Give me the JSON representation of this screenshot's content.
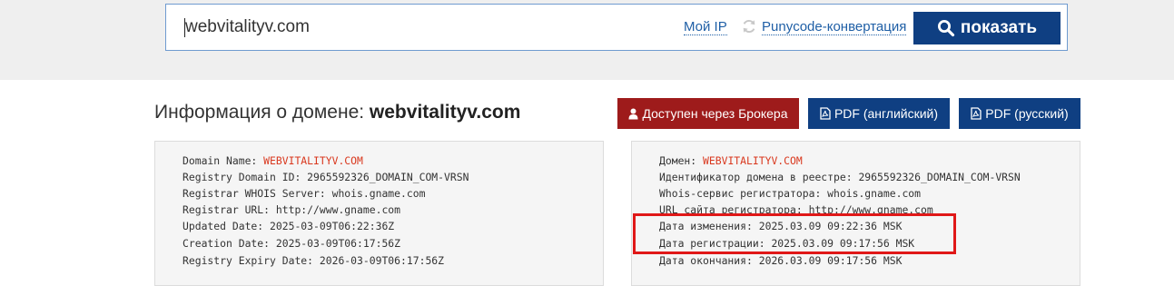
{
  "search": {
    "value": "webvitalityv.com",
    "my_ip_label": "Мой IP",
    "punycode_label": "Punycode-конвертация",
    "show_button_label": "показать"
  },
  "title": {
    "prefix": "Информация о домене: ",
    "domain": "webvitalityv.com"
  },
  "actions": {
    "broker_label": "Доступен через Брокера",
    "pdf_en_label": "PDF (английский)",
    "pdf_ru_label": "PDF (русский)"
  },
  "whois_en": [
    {
      "key": "Domain Name: ",
      "value": "WEBVITALITYV.COM"
    },
    {
      "key": "Registry Domain ID: 2965592326_DOMAIN_COM-VRSN",
      "value": ""
    },
    {
      "key": "Registrar WHOIS Server: whois.gname.com",
      "value": ""
    },
    {
      "key": "Registrar URL: http://www.gname.com",
      "value": ""
    },
    {
      "key": "Updated Date: 2025-03-09T06:22:36Z",
      "value": ""
    },
    {
      "key": "Creation Date: 2025-03-09T06:17:56Z",
      "value": ""
    },
    {
      "key": "Registry Expiry Date: 2026-03-09T06:17:56Z",
      "value": ""
    }
  ],
  "whois_ru": [
    {
      "key": "Домен: ",
      "value": "WEBVITALITYV.COM"
    },
    {
      "key": "Идентификатор домена в реестре: 2965592326_DOMAIN_COM-VRSN",
      "value": ""
    },
    {
      "key": "Whois-сервис регистратора: whois.gname.com",
      "value": ""
    },
    {
      "key": "URL сайта регистратора: http://www.gname.com",
      "value": ""
    },
    {
      "key": "Дата изменения: 2025.03.09 09:22:36 MSK",
      "value": ""
    },
    {
      "key": "Дата регистрации: 2025.03.09 09:17:56 MSK",
      "value": ""
    },
    {
      "key": "Дата окончания: 2026.03.09 09:17:56 MSK",
      "value": ""
    }
  ],
  "colors": {
    "accent_blue": "#0f3f82",
    "broker_red": "#9e1b1b",
    "highlight_red": "#e01818",
    "domain_orange": "#d9381e"
  }
}
